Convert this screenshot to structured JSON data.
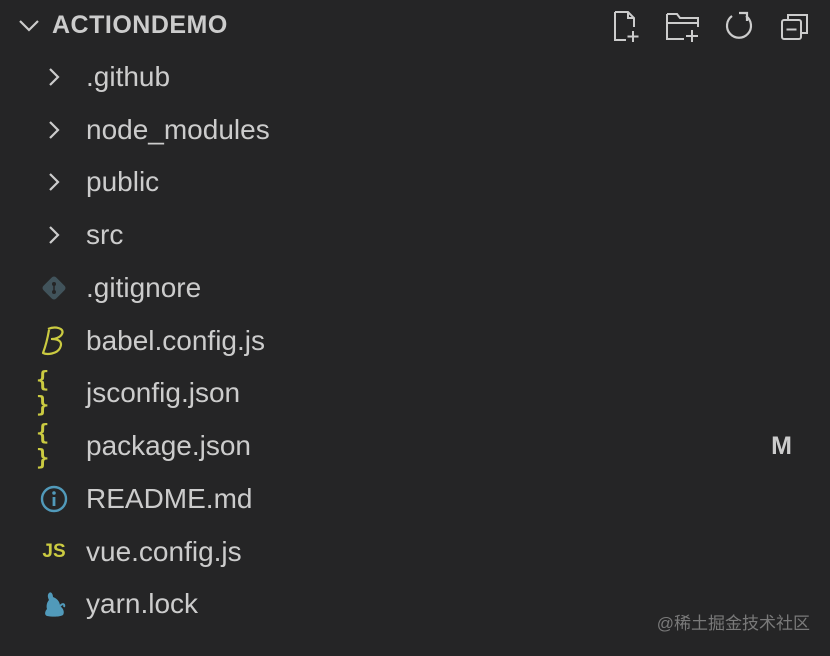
{
  "explorer": {
    "title": "ACTIONDEMO",
    "actions": [
      {
        "name": "new-file-icon"
      },
      {
        "name": "new-folder-icon"
      },
      {
        "name": "refresh-icon"
      },
      {
        "name": "collapse-all-icon"
      }
    ],
    "items": [
      {
        "label": ".github",
        "type": "folder",
        "icon": "chevron-right-icon"
      },
      {
        "label": "node_modules",
        "type": "folder",
        "icon": "chevron-right-icon"
      },
      {
        "label": "public",
        "type": "folder",
        "icon": "chevron-right-icon"
      },
      {
        "label": "src",
        "type": "folder",
        "icon": "chevron-right-icon"
      },
      {
        "label": ".gitignore",
        "type": "file",
        "icon": "git-icon"
      },
      {
        "label": "babel.config.js",
        "type": "file",
        "icon": "babel-icon"
      },
      {
        "label": "jsconfig.json",
        "type": "file",
        "icon": "json-icon"
      },
      {
        "label": "package.json",
        "type": "file",
        "icon": "json-icon",
        "badge": "M"
      },
      {
        "label": "README.md",
        "type": "file",
        "icon": "info-icon"
      },
      {
        "label": "vue.config.js",
        "type": "file",
        "icon": "js-icon"
      },
      {
        "label": "yarn.lock",
        "type": "file",
        "icon": "yarn-icon"
      }
    ]
  },
  "icons": {
    "json_glyph": "{ }",
    "js_glyph": "JS"
  },
  "watermark": "@稀土掘金技术社区",
  "colors": {
    "background": "#252526",
    "text": "#cccccc",
    "json": "#cbcb41",
    "js": "#cbcb41",
    "info": "#519aba",
    "git": "#41535b",
    "babel": "#cbcb41",
    "yarn": "#519aba"
  }
}
